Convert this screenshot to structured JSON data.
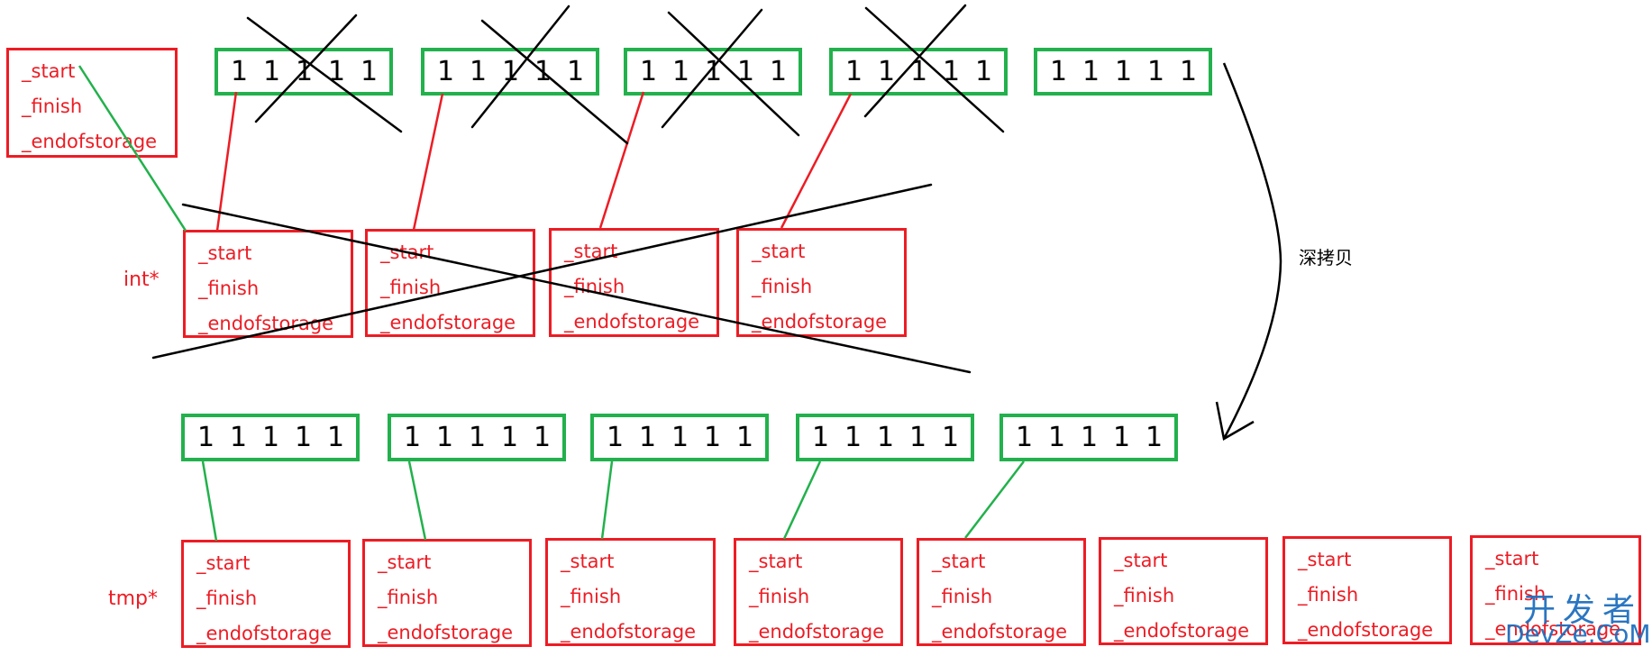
{
  "colors": {
    "array_border": "#22b14c",
    "struct_border": "#ed1c24",
    "cross_line": "#000000",
    "watermark": "#1f6fbf"
  },
  "source_vector": {
    "fields": [
      "_start",
      "_finish",
      "_endofstorage"
    ]
  },
  "old_arrays": [
    {
      "values": [
        "1",
        "1",
        "1",
        "1",
        "1"
      ],
      "crossed_out": true
    },
    {
      "values": [
        "1",
        "1",
        "1",
        "1",
        "1"
      ],
      "crossed_out": true
    },
    {
      "values": [
        "1",
        "1",
        "1",
        "1",
        "1"
      ],
      "crossed_out": true
    },
    {
      "values": [
        "1",
        "1",
        "1",
        "1",
        "1"
      ],
      "crossed_out": true
    },
    {
      "values": [
        "1",
        "1",
        "1",
        "1",
        "1"
      ],
      "crossed_out": false
    }
  ],
  "int_row": {
    "label": "int*",
    "crossed_out": true,
    "boxes": [
      {
        "fields": [
          "_start",
          "_finish",
          "_endofstorage"
        ]
      },
      {
        "fields": [
          "_start",
          "_finish",
          "_endofstorage"
        ]
      },
      {
        "fields": [
          "_start",
          "_finish",
          "_endofstorage"
        ]
      },
      {
        "fields": [
          "_start",
          "_finish",
          "_endofstorage"
        ]
      }
    ]
  },
  "copy_arrow": {
    "label": "深拷贝"
  },
  "new_arrays": [
    {
      "values": [
        "1",
        "1",
        "1",
        "1",
        "1"
      ]
    },
    {
      "values": [
        "1",
        "1",
        "1",
        "1",
        "1"
      ]
    },
    {
      "values": [
        "1",
        "1",
        "1",
        "1",
        "1"
      ]
    },
    {
      "values": [
        "1",
        "1",
        "1",
        "1",
        "1"
      ]
    },
    {
      "values": [
        "1",
        "1",
        "1",
        "1",
        "1"
      ]
    }
  ],
  "tmp_row": {
    "label": "tmp*",
    "boxes": [
      {
        "fields": [
          "_start",
          "_finish",
          "_endofstorage"
        ]
      },
      {
        "fields": [
          "_start",
          "_finish",
          "_endofstorage"
        ]
      },
      {
        "fields": [
          "_start",
          "_finish",
          "_endofstorage"
        ]
      },
      {
        "fields": [
          "_start",
          "_finish",
          "_endofstorage"
        ]
      },
      {
        "fields": [
          "_start",
          "_finish",
          "_endofstorage"
        ]
      },
      {
        "fields": [
          "_start",
          "_finish",
          "_endofstorage"
        ]
      },
      {
        "fields": [
          "_start",
          "_finish",
          "_endofstorage"
        ]
      },
      {
        "fields": [
          "_start",
          "_finish",
          "_endofstorage"
        ]
      }
    ]
  },
  "watermark": {
    "line1": "开发者",
    "line2": "DevZe.CoM"
  }
}
